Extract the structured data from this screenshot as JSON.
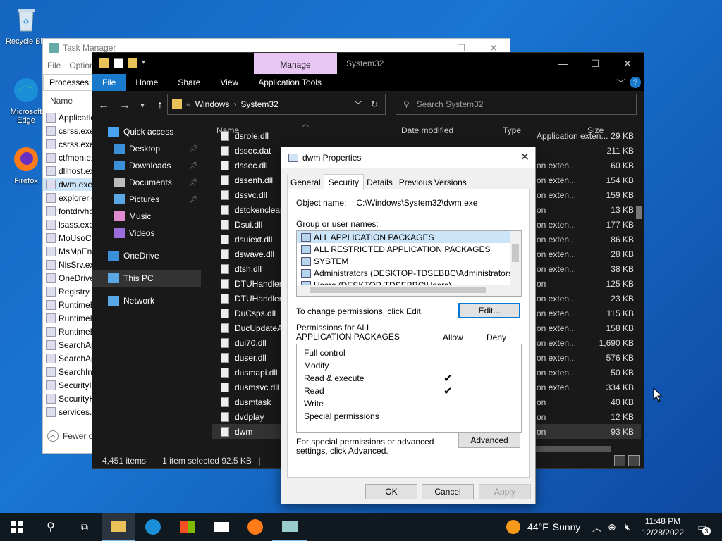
{
  "desktop": {
    "icons": [
      {
        "label": "Recycle Bin"
      },
      {
        "label": "Microsoft Edge"
      },
      {
        "label": "Firefox"
      }
    ]
  },
  "taskmgr": {
    "title": "Task Manager",
    "menu": [
      "File",
      "Options"
    ],
    "tab": "Processes",
    "col_name": "Name",
    "rows": [
      "Application...",
      "csrss.exe",
      "csrss.exe",
      "ctfmon.exe",
      "dllhost.exe",
      "dwm.exe",
      "explorer.exe",
      "fontdrvhost",
      "lsass.exe",
      "MoUsoCore",
      "MsMpEng",
      "NisSrv.exe",
      "OneDrive",
      "Registry",
      "RuntimeBroker",
      "RuntimeBroker",
      "RuntimeBroker",
      "SearchApp",
      "SearchApp",
      "SearchIndexer",
      "SecurityHealth",
      "SecurityHealth",
      "services.exe"
    ],
    "fewer": "Fewer details"
  },
  "explorer": {
    "manage": "Manage",
    "title": "System32",
    "ribbon": [
      "File",
      "Home",
      "Share",
      "View",
      "Application Tools"
    ],
    "address": [
      "Windows",
      "System32"
    ],
    "search_placeholder": "Search System32",
    "nav": [
      {
        "label": "Quick access",
        "icon": "star-icon",
        "pin": false
      },
      {
        "label": "Desktop",
        "icon": "desktop-icon",
        "pin": true
      },
      {
        "label": "Downloads",
        "icon": "download-icon",
        "pin": true
      },
      {
        "label": "Documents",
        "icon": "documents-icon",
        "pin": true
      },
      {
        "label": "Pictures",
        "icon": "pictures-icon",
        "pin": true
      },
      {
        "label": "Music",
        "icon": "music-icon",
        "pin": false
      },
      {
        "label": "Videos",
        "icon": "videos-icon",
        "pin": false
      },
      {
        "label": "OneDrive",
        "icon": "cloud-icon",
        "pin": false
      },
      {
        "label": "This PC",
        "icon": "pc-icon",
        "pin": false
      },
      {
        "label": "Network",
        "icon": "network-icon",
        "pin": false
      }
    ],
    "columns": [
      "Name",
      "Date modified",
      "Type",
      "Size"
    ],
    "files": [
      {
        "name": "dsrole.dll",
        "type": "Application exten...",
        "size": "29 KB"
      },
      {
        "name": "dssec.dat",
        "type": "",
        "size": "211 KB"
      },
      {
        "name": "dssec.dll",
        "type": "on exten...",
        "size": "60 KB"
      },
      {
        "name": "dssenh.dll",
        "type": "on exten...",
        "size": "154 KB"
      },
      {
        "name": "dssvc.dll",
        "type": "on exten...",
        "size": "159 KB"
      },
      {
        "name": "dstokenclean",
        "type": "on",
        "size": "13 KB"
      },
      {
        "name": "Dsui.dll",
        "type": "on exten...",
        "size": "177 KB"
      },
      {
        "name": "dsuiext.dll",
        "type": "on exten...",
        "size": "86 KB"
      },
      {
        "name": "dswave.dll",
        "type": "on exten...",
        "size": "28 KB"
      },
      {
        "name": "dtsh.dll",
        "type": "on exten...",
        "size": "38 KB"
      },
      {
        "name": "DTUHandler",
        "type": "on",
        "size": "125 KB"
      },
      {
        "name": "DTUHandlerP",
        "type": "on exten...",
        "size": "23 KB"
      },
      {
        "name": "DuCsps.dll",
        "type": "on exten...",
        "size": "115 KB"
      },
      {
        "name": "DucUpdateAg",
        "type": "on exten...",
        "size": "158 KB"
      },
      {
        "name": "dui70.dll",
        "type": "on exten...",
        "size": "1,690 KB"
      },
      {
        "name": "duser.dll",
        "type": "on exten...",
        "size": "576 KB"
      },
      {
        "name": "dusmapi.dll",
        "type": "on exten...",
        "size": "50 KB"
      },
      {
        "name": "dusmsvc.dll",
        "type": "on exten...",
        "size": "334 KB"
      },
      {
        "name": "dusmtask",
        "type": "on",
        "size": "40 KB"
      },
      {
        "name": "dvdplay",
        "type": "on",
        "size": "12 KB"
      },
      {
        "name": "dwm",
        "type": "on",
        "size": "93 KB"
      }
    ],
    "status_items": "4,451 items",
    "status_selected": "1 item selected  92.5 KB"
  },
  "props": {
    "title": "dwm Properties",
    "tabs": [
      "General",
      "Security",
      "Details",
      "Previous Versions"
    ],
    "object_label": "Object name:",
    "object_value": "C:\\Windows\\System32\\dwm.exe",
    "group_label": "Group or user names:",
    "users": [
      "ALL APPLICATION PACKAGES",
      "ALL RESTRICTED APPLICATION PACKAGES",
      "SYSTEM",
      "Administrators (DESKTOP-TDSEBBC\\Administrators)",
      "Users (DESKTOP-TDSEBBC\\Users)"
    ],
    "change_text": "To change permissions, click Edit.",
    "edit_btn": "Edit...",
    "perm_for": "Permissions for ALL APPLICATION PACKAGES",
    "allow": "Allow",
    "deny": "Deny",
    "perms": [
      {
        "name": "Full control",
        "allow": false
      },
      {
        "name": "Modify",
        "allow": false
      },
      {
        "name": "Read & execute",
        "allow": true
      },
      {
        "name": "Read",
        "allow": true
      },
      {
        "name": "Write",
        "allow": false
      },
      {
        "name": "Special permissions",
        "allow": false
      }
    ],
    "special_text": "For special permissions or advanced settings, click Advanced.",
    "advanced_btn": "Advanced",
    "ok": "OK",
    "cancel": "Cancel",
    "apply": "Apply"
  },
  "taskbar": {
    "weather_temp": "44°F",
    "weather_text": "Sunny",
    "time": "11:48 PM",
    "date": "12/28/2022",
    "notif_count": "3"
  },
  "colors": {
    "explorer_bg": "#191919",
    "manage_tab": "#e8c6f4",
    "accent": "#1979ca",
    "taskbar": "#101820"
  }
}
